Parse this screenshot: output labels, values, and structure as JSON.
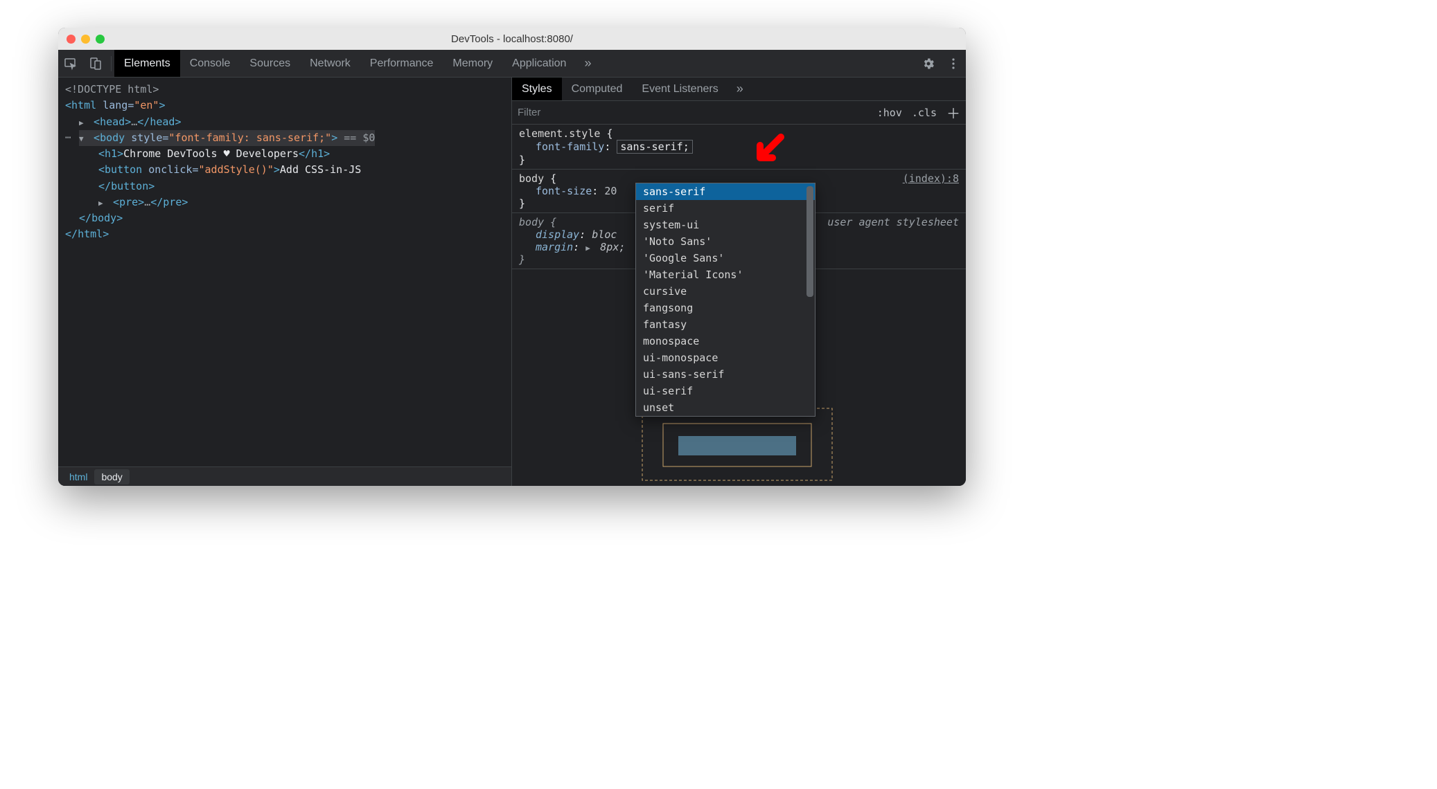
{
  "window": {
    "title": "DevTools - localhost:8080/"
  },
  "mainTabs": [
    "Elements",
    "Console",
    "Sources",
    "Network",
    "Performance",
    "Memory",
    "Application"
  ],
  "mainTabActive": 0,
  "dom": {
    "doctype": "<!DOCTYPE html>",
    "htmlOpen": "html",
    "htmlAttr": {
      "name": "lang",
      "value": "\"en\""
    },
    "headOpen": "head",
    "headEllipsis": "…",
    "headClose": "head",
    "bodyOpen": "body",
    "bodyAttr": {
      "name": "style",
      "value": "\"font-family: sans-serif;\""
    },
    "bodyEq": " == $0",
    "h1Open": "h1",
    "h1Text": "Chrome DevTools ♥ Developers",
    "h1Close": "h1",
    "buttonOpen": "button",
    "buttonAttr": {
      "name": "onclick",
      "value": "\"addStyle()\""
    },
    "buttonText": "Add CSS-in-JS",
    "buttonClose": "button",
    "preOpen": "pre",
    "preEllipsis": "…",
    "preClose": "pre",
    "bodyClose": "body",
    "htmlClose": "html"
  },
  "breadcrumbs": [
    "html",
    "body"
  ],
  "stylesTabs": [
    "Styles",
    "Computed",
    "Event Listeners"
  ],
  "stylesTabActive": 0,
  "filter": {
    "placeholder": "Filter",
    "hov": ":hov",
    "cls": ".cls"
  },
  "rules": [
    {
      "selector": "element.style",
      "brace": "{",
      "props": [
        {
          "name": "font-family",
          "value": "sans-serif",
          "editing": true
        }
      ],
      "close": "}"
    },
    {
      "selector": "body",
      "brace": "{",
      "source": "(index):8",
      "props": [
        {
          "name": "font-size",
          "value": "20"
        }
      ],
      "close": "}"
    },
    {
      "selector": "body",
      "brace": "{",
      "italic": true,
      "source": "user agent stylesheet",
      "sourceItalic": true,
      "props": [
        {
          "name": "display",
          "value": "bloc",
          "italic": true
        },
        {
          "name": "margin",
          "value": "8px;",
          "italic": true,
          "expand": true
        }
      ],
      "close": "}"
    }
  ],
  "dropdown": {
    "items": [
      "sans-serif",
      "serif",
      "system-ui",
      "'Noto Sans'",
      "'Google Sans'",
      "'Material Icons'",
      "cursive",
      "fangsong",
      "fantasy",
      "monospace",
      "ui-monospace",
      "ui-sans-serif",
      "ui-serif",
      "unset"
    ],
    "selectedIndex": 0
  }
}
